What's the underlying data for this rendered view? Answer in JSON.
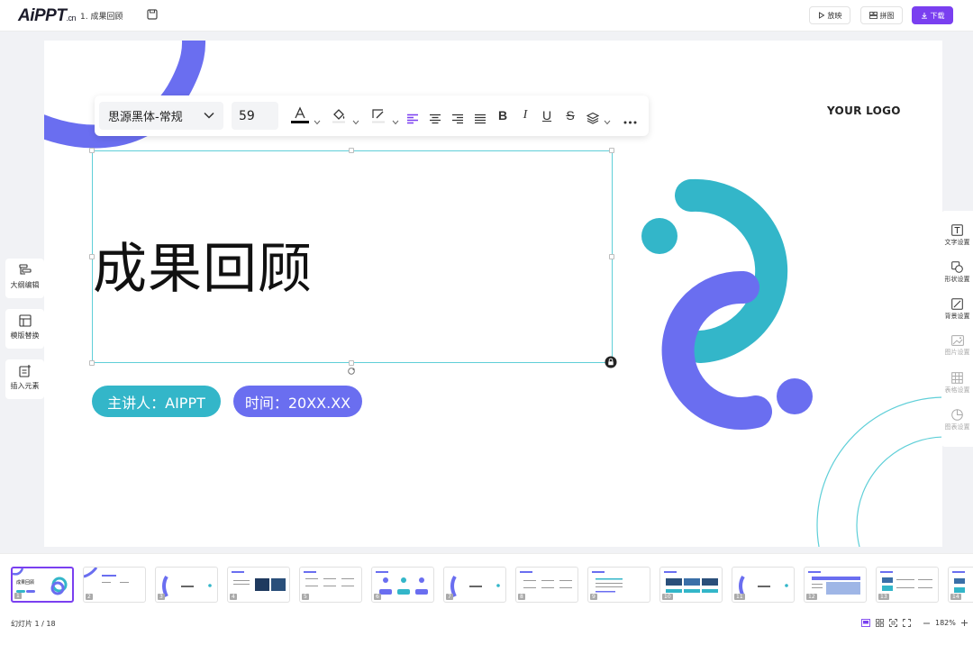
{
  "app": {
    "logo_main": "AiPPT",
    "logo_suffix": ".cn",
    "doc_title": "1. 成果回顾"
  },
  "toolbar": {
    "play_label": "放映",
    "layout_label": "拼图",
    "download_label": "下载"
  },
  "slide": {
    "logo_text": "YOUR LOGO",
    "title": "成果回顾",
    "presenter": "主讲人：AIPPT",
    "time": "时间：20XX.XX"
  },
  "format_bar": {
    "font_family": "思源黑体-常规",
    "font_size": "59"
  },
  "left_tools": [
    {
      "label": "大纲编辑"
    },
    {
      "label": "模版替换"
    },
    {
      "label": "插入元素"
    }
  ],
  "right_tools": [
    {
      "label": "文字设置",
      "enabled": true
    },
    {
      "label": "形状设置",
      "enabled": true
    },
    {
      "label": "背景设置",
      "enabled": true
    },
    {
      "label": "图片设置",
      "enabled": false
    },
    {
      "label": "表格设置",
      "enabled": false
    },
    {
      "label": "图表设置",
      "enabled": false
    }
  ],
  "thumbnails": {
    "numbers": [
      "1",
      "2",
      "3",
      "4",
      "5",
      "6",
      "7",
      "8",
      "9",
      "10",
      "11",
      "12",
      "13",
      "14"
    ],
    "active": "1",
    "first_title": "成果回顾"
  },
  "footer": {
    "slide_count": "幻灯片 1 / 18",
    "zoom": "182%"
  },
  "colors": {
    "accent": "#7a3ff0",
    "teal": "#33b6c9",
    "purple": "#6a6ef0"
  }
}
